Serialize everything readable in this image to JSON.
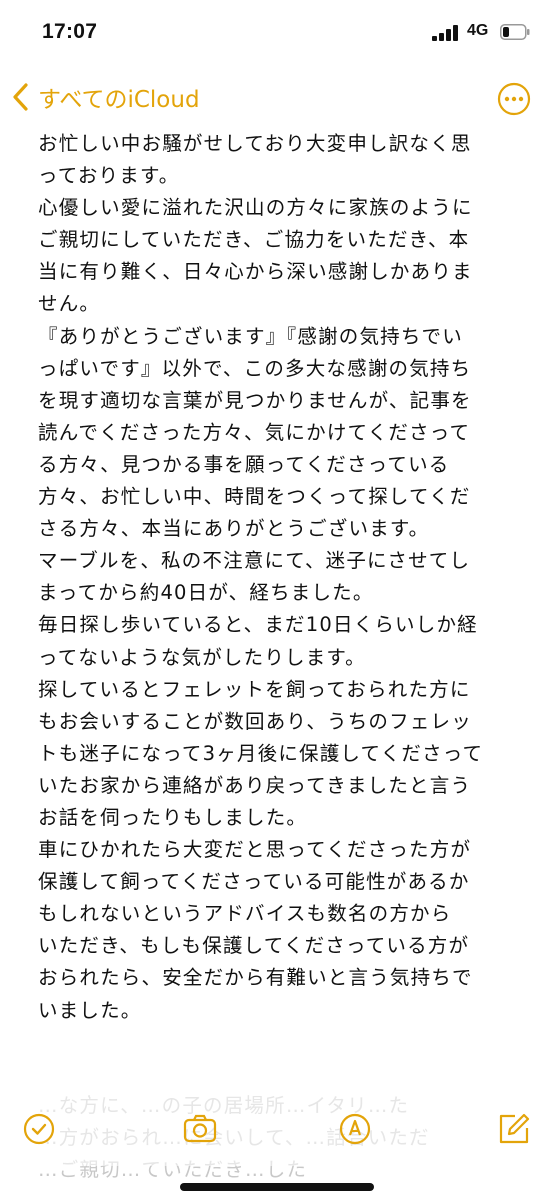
{
  "status_bar": {
    "time": "17:07",
    "network": "4G"
  },
  "nav": {
    "back_label": "すべてのiCloud"
  },
  "note": {
    "lines": [
      "お忙しい中お騒がせしており大変申し訳なく思",
      "っております。",
      "心優しい愛に溢れた沢山の方々に家族のように",
      "ご親切にしていただき、ご協力をいただき、本",
      "当に有り難く、日々心から深い感謝しかありま",
      "せん。",
      "『ありがとうございます』『感謝の気持ちでい",
      "っぱいです』以外で、この多大な感謝の気持ち",
      "を現す適切な言葉が見つかりませんが、記事を",
      "読んでくださった方々、気にかけてくださって",
      "る方々、見つかる事を願ってくださっている",
      "方々、お忙しい中、時間をつくって探してくだ",
      "さる方々、本当にありがとうございます。",
      "マーブルを、私の不注意にて、迷子にさせてし",
      "まってから約40日が、経ちました。",
      "毎日探し歩いていると、まだ10日くらいしか経",
      "ってないような気がしたりします。",
      "探しているとフェレットを飼っておられた方に",
      "もお会いすることが数回あり、うちのフェレッ",
      "トも迷子になって3ヶ月後に保護してくださって",
      "いたお家から連絡があり戻ってきましたと言う",
      "お話を伺ったりもしました。",
      "車にひかれたら大変だと思ってくださった方が",
      "保護して飼ってくださっている可能性があるか",
      "もしれないというアドバイスも数名の方から",
      "いただき、もしも保護してくださっている方が",
      "おられたら、安全だから有難いと言う気持ちで",
      "いました。"
    ],
    "faded_lines": [
      "…な方に、…の子の居場所…イタリ…た",
      "…方がおられ…に会いして、…話合いただ",
      "…ご親切…ていただき…した"
    ]
  }
}
